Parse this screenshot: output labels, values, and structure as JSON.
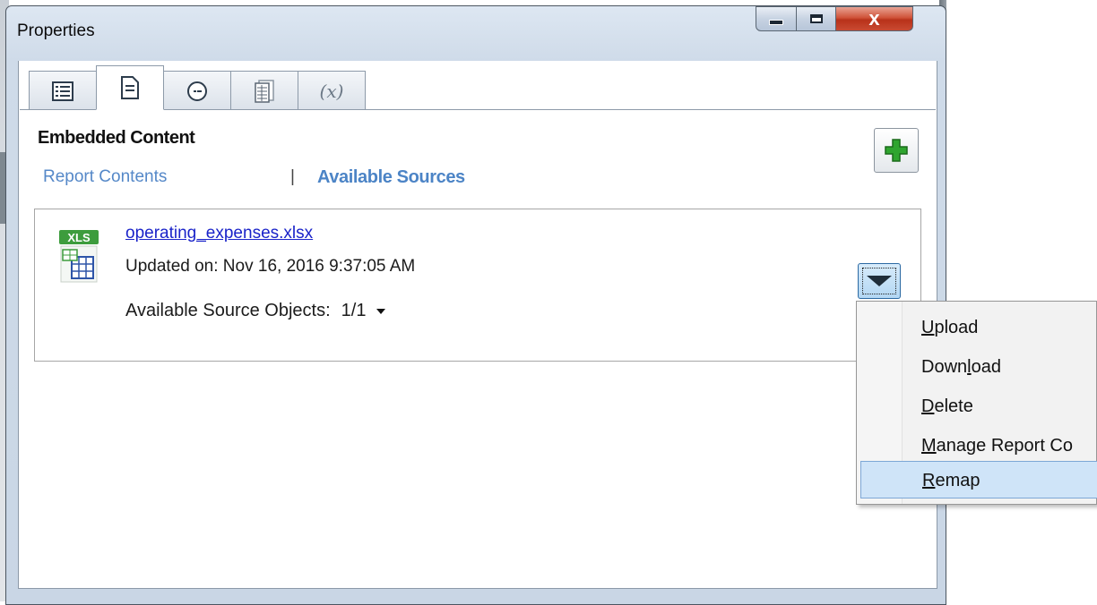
{
  "window": {
    "title": "Properties",
    "close_label": "x"
  },
  "tabs": [
    {
      "name": "general",
      "icon": "list-icon"
    },
    {
      "name": "embedded-content",
      "icon": "document-icon",
      "active": true
    },
    {
      "name": "schedule",
      "icon": "clock-icon"
    },
    {
      "name": "data",
      "icon": "grid-document-icon"
    },
    {
      "name": "variables",
      "icon": "variable-icon",
      "label": "(x)"
    }
  ],
  "section": {
    "title": "Embedded Content",
    "links": {
      "report_contents": "Report Contents",
      "separator": "|",
      "available_sources": "Available Sources"
    }
  },
  "source": {
    "badge": "XLS",
    "file_name": "operating_expenses.xlsx",
    "updated": "Updated on: Nov 16, 2016 9:37:05 AM",
    "objects_label": "Available Source Objects:",
    "objects_value": "1/1"
  },
  "menu": {
    "items": [
      {
        "key": "U",
        "rest": "pload",
        "pre": ""
      },
      {
        "key": "l",
        "rest": "oad",
        "pre": "Down"
      },
      {
        "key": "D",
        "rest": "elete",
        "pre": ""
      },
      {
        "key": "M",
        "rest": "anage Report Co",
        "pre": ""
      },
      {
        "key": "R",
        "rest": "emap",
        "pre": "",
        "highlighted": true
      }
    ]
  },
  "colors": {
    "link": "#5588c8",
    "file_link": "#1a23c9",
    "menu_highlight": "#cfe4f8",
    "add_icon": "#2fa52f"
  }
}
